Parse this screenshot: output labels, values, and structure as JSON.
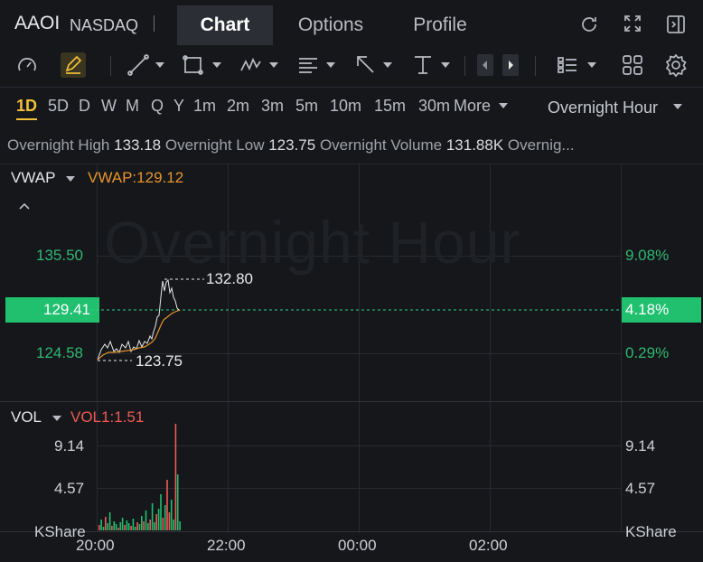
{
  "header": {
    "symbol": "AAOI",
    "exchange": "NASDAQ",
    "tabs": [
      {
        "label": "Chart",
        "active": true
      },
      {
        "label": "Options",
        "active": false
      },
      {
        "label": "Profile",
        "active": false
      }
    ],
    "icons": [
      "refresh-icon",
      "expand-icon",
      "collapse-panel-icon"
    ]
  },
  "toolbar": {
    "icons": [
      "gauge-icon",
      "pen-icon",
      "trend-line-icon",
      "rectangle-icon",
      "wave-pattern-icon",
      "fib-text-icon",
      "arrow-icon",
      "price-range-icon",
      "prev-icon",
      "next-icon",
      "layout-list-icon",
      "grid-icon",
      "settings-icon"
    ]
  },
  "periods": {
    "items": [
      "1D",
      "5D",
      "D",
      "W",
      "M",
      "Q",
      "Y",
      "1m",
      "2m",
      "3m",
      "5m",
      "10m",
      "15m",
      "30m"
    ],
    "active": "1D",
    "more_label": "More",
    "session_label": "Overnight Hour"
  },
  "info": {
    "high_label": "Overnight High",
    "high_value": "133.18",
    "low_label": "Overnight Low",
    "low_value": "123.75",
    "volume_label": "Overnight Volume",
    "volume_value": "131.88K",
    "more_label": "Overnig..."
  },
  "chart": {
    "watermark": "Overnight Hour",
    "indicator_label": "VWAP",
    "indicator_value": "VWAP:129.12",
    "price_axis": {
      "top": "135.50",
      "current": "129.41",
      "bottom": "124.58"
    },
    "pct_axis": {
      "top": "9.08%",
      "current": "4.18%",
      "bottom": "0.29%"
    },
    "high_marker": "132.80",
    "low_marker": "123.75",
    "volume_label": "VOL",
    "volume_value": "VOL1:1.51",
    "volume_axis_left": {
      "top": "9.14",
      "mid": "4.57",
      "unit": "KShare"
    },
    "volume_axis_right": {
      "top": "9.14",
      "mid": "4.57",
      "unit": "KShare"
    },
    "time_labels": [
      "20:00",
      "22:00",
      "00:00",
      "02:00"
    ],
    "colors": {
      "up": "#20c06f",
      "down": "#ef5a57",
      "vwap": "#e6952c",
      "price": "#e8e8e8"
    }
  }
}
